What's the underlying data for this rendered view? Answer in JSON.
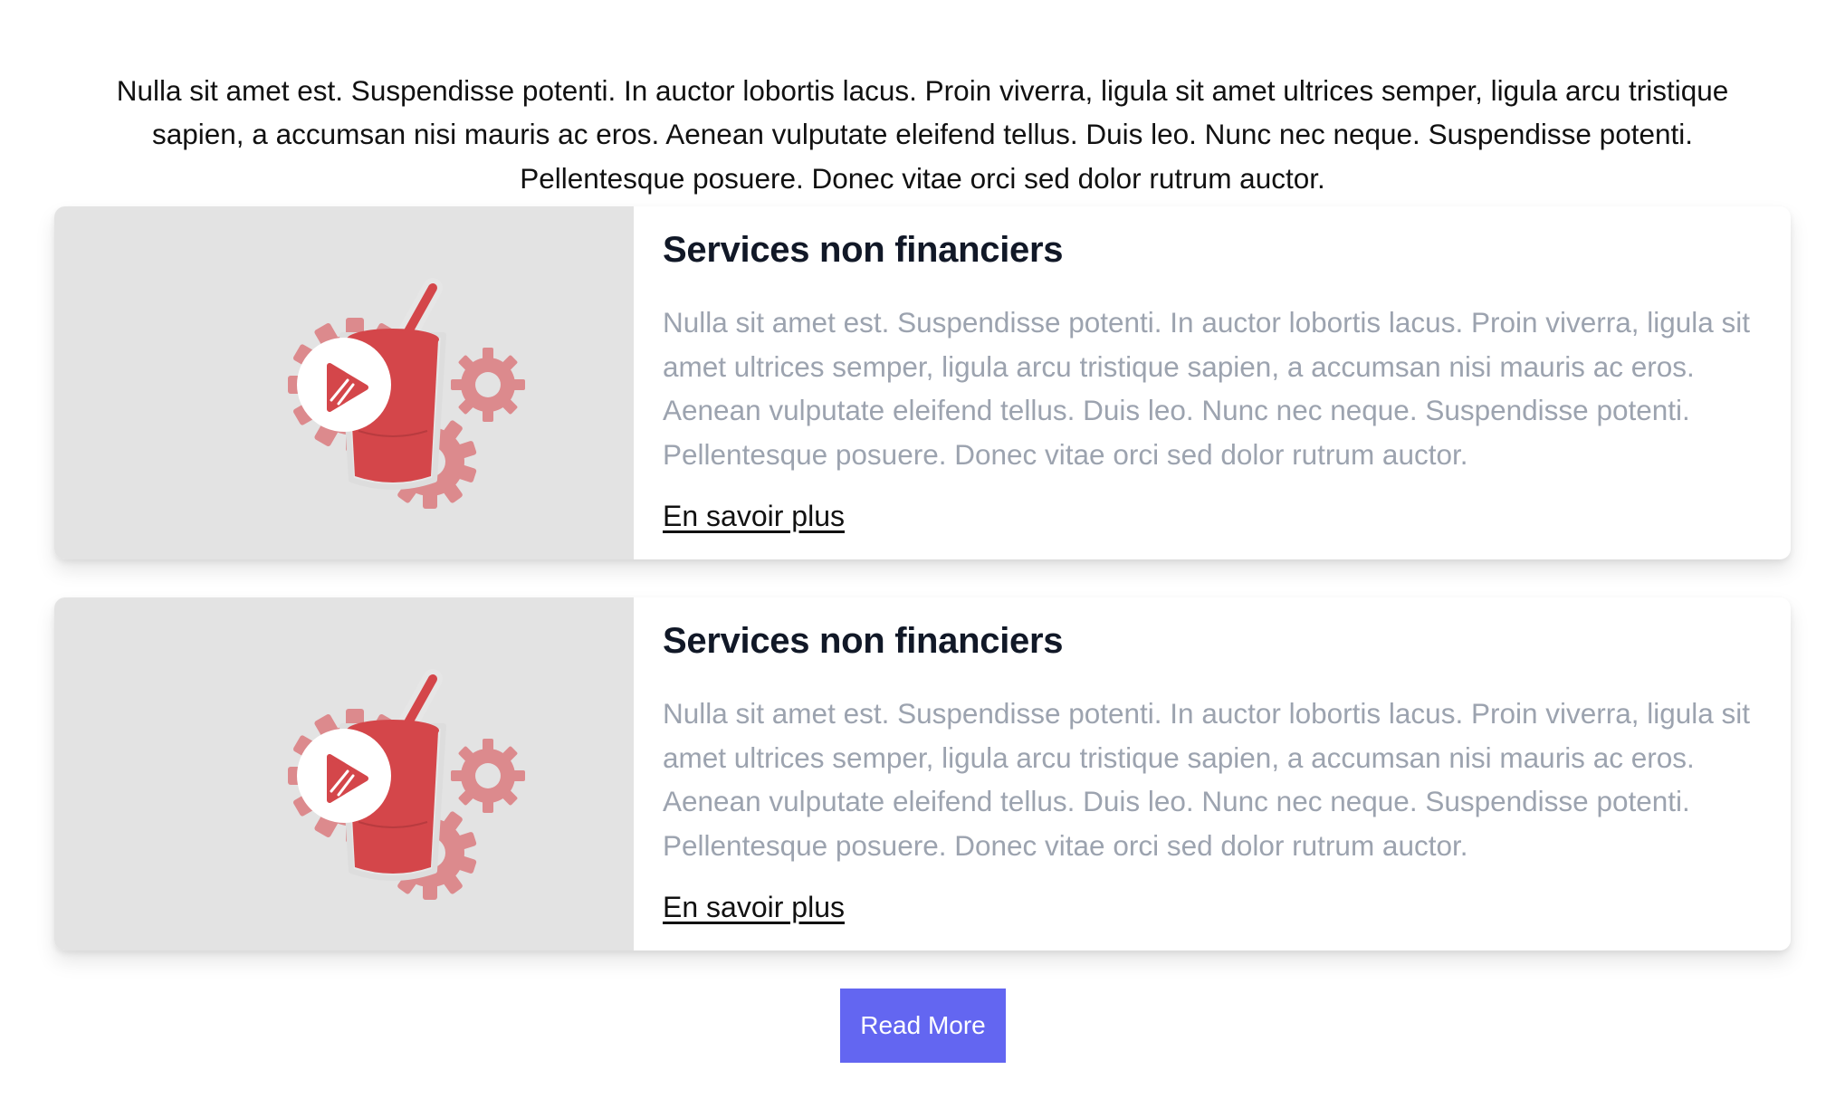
{
  "intro": {
    "text": "Nulla sit amet est. Suspendisse potenti. In auctor lobortis lacus. Proin viverra, ligula sit amet ultrices semper, ligula arcu tristique sapien, a accumsan nisi mauris ac eros. Aenean vulputate eleifend tellus. Duis leo. Nunc nec neque. Suspendisse potenti. Pellentesque posuere. Donec vitae orci sed dolor rutrum auctor."
  },
  "cards": [
    {
      "title": "Services non financiers",
      "description": "Nulla sit amet est. Suspendisse potenti. In auctor lobortis lacus. Proin viverra, ligula sit amet ultrices semper, ligula arcu tristique sapien, a accumsan nisi mauris ac eros. Aenean vulputate eleifend tellus. Duis leo. Nunc nec neque. Suspendisse potenti. Pellentesque posuere. Donec vitae orci sed dolor rutrum auctor.",
      "link_label": "En savoir plus",
      "media_icon": "gears-cup-play-icon"
    },
    {
      "title": "Services non financiers",
      "description": "Nulla sit amet est. Suspendisse potenti. In auctor lobortis lacus. Proin viverra, ligula sit amet ultrices semper, ligula arcu tristique sapien, a accumsan nisi mauris ac eros. Aenean vulputate eleifend tellus. Duis leo. Nunc nec neque. Suspendisse potenti. Pellentesque posuere. Donec vitae orci sed dolor rutrum auctor.",
      "link_label": "En savoir plus",
      "media_icon": "gears-cup-play-icon"
    }
  ],
  "read_more": {
    "label": "Read More"
  },
  "colors": {
    "accent": "#6366f1",
    "title": "#111827",
    "muted_text": "#9ca3af",
    "media_bg": "#e3e3e3",
    "gear": "#dc8a8d",
    "cup": "#d4464a"
  }
}
